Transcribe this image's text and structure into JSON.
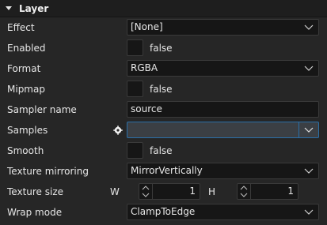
{
  "section": {
    "title": "Layer"
  },
  "properties": {
    "effect": {
      "label": "Effect",
      "value": "[None]"
    },
    "enabled": {
      "label": "Enabled",
      "value": "false"
    },
    "format": {
      "label": "Format",
      "value": "RGBA"
    },
    "mipmap": {
      "label": "Mipmap",
      "value": "false"
    },
    "sampler_name": {
      "label": "Sampler name",
      "value": "source"
    },
    "samples": {
      "label": "Samples",
      "value": ""
    },
    "smooth": {
      "label": "Smooth",
      "value": "false"
    },
    "texture_mirroring": {
      "label": "Texture mirroring",
      "value": "MirrorVertically"
    },
    "texture_size": {
      "label": "Texture size",
      "w_label": "W",
      "w_value": "1",
      "h_label": "H",
      "h_value": "1"
    },
    "wrap_mode": {
      "label": "Wrap mode",
      "value": "ClampToEdge"
    }
  },
  "colors": {
    "background": "#262626",
    "field_background": "#161616",
    "focus_border": "#2a6fa8",
    "text": "#e6e6e6"
  }
}
